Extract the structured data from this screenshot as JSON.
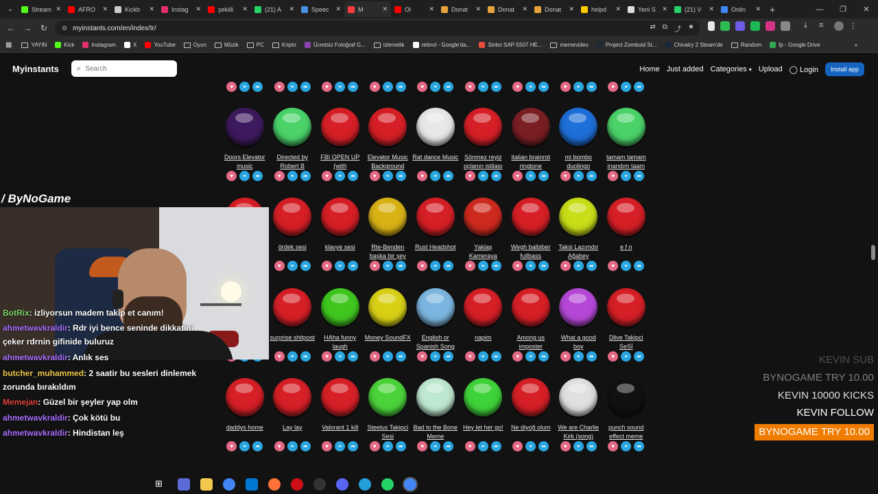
{
  "browser": {
    "tabs": [
      {
        "label": "Stream",
        "color": "#53fc18"
      },
      {
        "label": "AFRO",
        "color": "#ff0000"
      },
      {
        "label": "Kickb",
        "color": "#cccccc"
      },
      {
        "label": "Instag",
        "color": "#e1306c"
      },
      {
        "label": "şekilli",
        "color": "#ff0000"
      },
      {
        "label": "(21) A",
        "color": "#25d366"
      },
      {
        "label": "Speec",
        "color": "#4a90e2"
      },
      {
        "label": "M",
        "color": "#ff3b3b",
        "active": true
      },
      {
        "label": "Ol",
        "color": "#ff0000"
      },
      {
        "label": "Donat",
        "color": "#e6a23c"
      },
      {
        "label": "Donat",
        "color": "#e6a23c"
      },
      {
        "label": "Donat",
        "color": "#e6a23c"
      },
      {
        "label": "helpd",
        "color": "#ffcc00"
      },
      {
        "label": "Yeni S",
        "color": "#dddddd"
      },
      {
        "label": "(21) V",
        "color": "#25d366"
      },
      {
        "label": "Onlin",
        "color": "#4285f4"
      }
    ],
    "url": "myinstants.com/en/index/tr/",
    "bookmarks": [
      {
        "label": "YAYIN",
        "type": "folder"
      },
      {
        "label": "Kick",
        "type": "link",
        "color": "#53fc18"
      },
      {
        "label": "Instagram",
        "type": "link",
        "color": "#e1306c"
      },
      {
        "label": "X",
        "type": "link",
        "color": "#ffffff"
      },
      {
        "label": "YouTube",
        "type": "link",
        "color": "#ff0000"
      },
      {
        "label": "Oyun",
        "type": "folder"
      },
      {
        "label": "Müzik",
        "type": "folder"
      },
      {
        "label": "PC",
        "type": "folder"
      },
      {
        "label": "Kripto",
        "type": "folder"
      },
      {
        "label": "Ücretsiz Fotoğraf G...",
        "type": "link",
        "color": "#8e44ad"
      },
      {
        "label": "izlemelik",
        "type": "folder"
      },
      {
        "label": "retinol - Google'da...",
        "type": "link",
        "color": "#ffffff"
      },
      {
        "label": "Sinbo SAP-5507 HE...",
        "type": "link",
        "color": "#e74c3c"
      },
      {
        "label": "memevideo",
        "type": "folder"
      },
      {
        "label": "Project Zomboid St...",
        "type": "link",
        "color": "#1b2838"
      },
      {
        "label": "Chivalry 2 Steam'de",
        "type": "link",
        "color": "#1b2838"
      },
      {
        "label": "Random",
        "type": "folder"
      },
      {
        "label": "fp - Google Drive",
        "type": "link",
        "color": "#34a853"
      }
    ]
  },
  "site": {
    "logo": "Myinstants",
    "search_placeholder": "Search",
    "nav": {
      "home": "Home",
      "just_added": "Just added",
      "categories": "Categories",
      "upload": "Upload",
      "login": "Login",
      "install": "Install app"
    }
  },
  "rows": [
    [
      {
        "label": "Doors Elevator music",
        "color": "#3d1a5e"
      },
      {
        "label": "Directed by Robert B",
        "color": "#4bd36a"
      },
      {
        "label": "FBI OPEN UP (with",
        "color": "#d61f26"
      },
      {
        "label": "Elevator Music Background",
        "color": "#d61f26"
      },
      {
        "label": "Rat dance Music",
        "color": "#e8e8e8"
      },
      {
        "label": "Sönmez reyiz oçlanın istilası",
        "color": "#d61f26"
      },
      {
        "label": "italian brainrot ringtone",
        "color": "#7a1f24"
      },
      {
        "label": "mi bombo duolingo",
        "color": "#1e6fd9"
      },
      {
        "label": "tamam tamam inandım taam",
        "color": "#4bd36a"
      }
    ],
    [
      {
        "label": "",
        "color": "#d61f26"
      },
      {
        "label": "ördek sesi",
        "color": "#d61f26"
      },
      {
        "label": "klavye sesi",
        "color": "#d61f26"
      },
      {
        "label": "Rte-Benden başka bir şey",
        "color": "#d9b216"
      },
      {
        "label": "Rust Headshot",
        "color": "#d61f26"
      },
      {
        "label": "Yaklaş Kameraya",
        "color": "#cf2a1f"
      },
      {
        "label": "Wegh balbiber fullbass",
        "color": "#d61f26"
      },
      {
        "label": "Taksi Lazımdır Ağabey",
        "color": "#c9dd18"
      },
      {
        "label": "e f n",
        "color": "#d61f26"
      }
    ],
    [
      {
        "label": "",
        "color": "#d61f26"
      },
      {
        "label": "surprise shitpost",
        "color": "#d61f26"
      },
      {
        "label": "HAha funny laugh",
        "color": "#3fc71f"
      },
      {
        "label": "Money SoundFX",
        "color": "#d9d016"
      },
      {
        "label": "English or Spanish Song",
        "color": "#7cb6e0"
      },
      {
        "label": "napim",
        "color": "#d61f26"
      },
      {
        "label": "Among us imposter",
        "color": "#d61f26"
      },
      {
        "label": "What a good boy",
        "color": "#b648d8"
      },
      {
        "label": "Dlive Takipci SeSİ",
        "color": "#d61f26"
      }
    ],
    [
      {
        "label": "daddys home",
        "color": "#d61f26"
      },
      {
        "label": "Lay lay",
        "color": "#d61f26"
      },
      {
        "label": "Valorant 1 kill",
        "color": "#d61f26"
      },
      {
        "label": "Steelus Takipci Sesi",
        "color": "#4bd33a"
      },
      {
        "label": "Bad to the Bone Meme",
        "color": "#bfe8d0"
      },
      {
        "label": "Hey let her go!",
        "color": "#3fd33a"
      },
      {
        "label": "Ne diyoğ olum",
        "color": "#d61f26"
      },
      {
        "label": "We are Charlie Kirk (song)",
        "color": "#e0e0e0"
      },
      {
        "label": "punch sound effect meme",
        "color": "#111111"
      }
    ]
  ],
  "stream": {
    "channel": "ByNoGame",
    "chat": [
      {
        "user": "BotRix",
        "text": ": izliyorsun madem takip et canım!",
        "cls": "g"
      },
      {
        "user": "ahmetwavkraldir",
        "text": ": Rdr iyi bence seninde dikkatini çeker rdrnin gifinide buluruz",
        "cls": ""
      },
      {
        "user": "ahmetwavkraldir",
        "text": ": Anlık ses",
        "cls": ""
      },
      {
        "user": "butcher_muhammed",
        "text": ": 2 saatir bu sesleri dinlemek zorunda bırakıldım",
        "cls": "y"
      },
      {
        "user": "Memejan",
        "text": ": Güzel bir şeyler yap olm",
        "cls": "r"
      },
      {
        "user": "ahmetwavkraldir",
        "text": ": Çok kötü bu",
        "cls": ""
      },
      {
        "user": "ahmetwavkraldir",
        "text": ": Hindistan leş",
        "cls": ""
      }
    ],
    "alerts": [
      "KEVIN   SUB",
      "BYNOGAME   TRY 10.00",
      "KEVIN   10000 KICKS",
      "KEVIN   FOLLOW",
      "BYNOGAME   TRY 10.00"
    ]
  }
}
